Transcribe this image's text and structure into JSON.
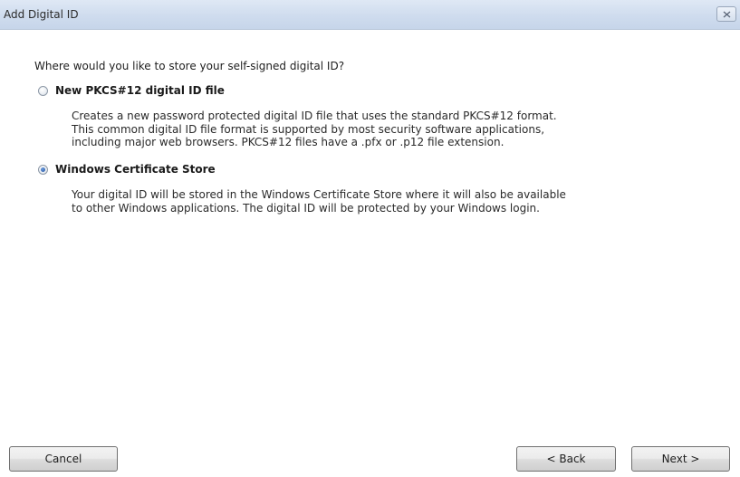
{
  "window": {
    "title": "Add Digital ID",
    "close_icon": "close-icon"
  },
  "content": {
    "question": "Where would you like to store your self-signed digital ID?",
    "options": [
      {
        "label": "New PKCS#12 digital ID file",
        "selected": false,
        "description": [
          "Creates a new password protected digital ID file that uses the standard PKCS#12 format.",
          "This common digital ID file format is supported by most security software applications,",
          "including major web browsers. PKCS#12 files have a .pfx or .p12 file extension."
        ]
      },
      {
        "label": "Windows Certificate Store",
        "selected": true,
        "description": [
          "Your digital ID will be stored in the Windows Certificate Store where it will also be available",
          "to other Windows applications. The digital ID will be protected by your Windows login."
        ]
      }
    ]
  },
  "buttons": {
    "cancel": "Cancel",
    "back": "< Back",
    "next": "Next >"
  },
  "colors": {
    "titlebar": "#cfdcee",
    "radio_selected": "#1f4f9b"
  }
}
